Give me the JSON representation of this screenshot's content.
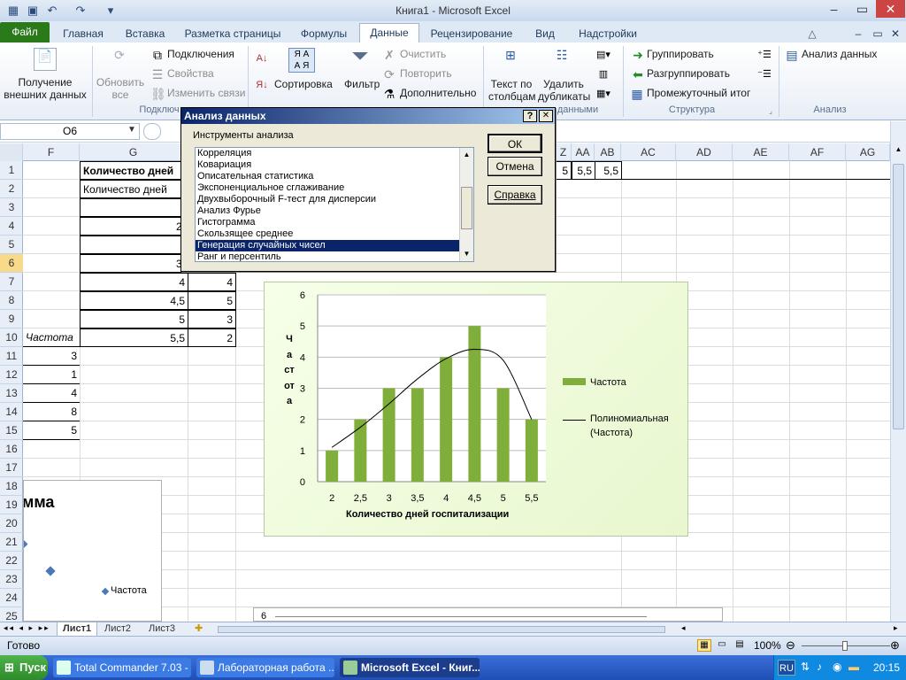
{
  "window": {
    "title": "Книга1  -  Microsoft Excel"
  },
  "tabs": [
    {
      "label": "Файл"
    },
    {
      "label": "Главная"
    },
    {
      "label": "Вставка"
    },
    {
      "label": "Разметка страницы"
    },
    {
      "label": "Формулы"
    },
    {
      "label": "Данные"
    },
    {
      "label": "Рецензирование"
    },
    {
      "label": "Вид"
    },
    {
      "label": "Надстройки"
    }
  ],
  "ribbon": {
    "get_data": "Получение внешних данных",
    "refresh": "Обновить все",
    "connections": "Подключения",
    "properties": "Свойства",
    "edit_links": "Изменить связи",
    "group_connections": "Подключ",
    "sort": "Сортировка",
    "filter": "Фильтр",
    "clear": "Очистить",
    "reapply": "Повторить",
    "advanced": "Дополнительно",
    "text_to_cols": "Текст по столбцам",
    "remove_dup": "Удалить дубликаты",
    "group_data": "данными",
    "group_btn": "Группировать",
    "ungroup_btn": "Разгруппировать",
    "subtotal": "Промежуточный итог",
    "group_structure": "Структура",
    "analysis_btn": "Анализ данных",
    "group_analysis": "Анализ"
  },
  "namebox": "O6",
  "columns": [
    "F",
    "G",
    "",
    "",
    "Z",
    "AA",
    "AB",
    "AC",
    "AD",
    "AE",
    "AF",
    "AG"
  ],
  "rows": [
    "1",
    "2",
    "3",
    "4",
    "5",
    "6",
    "7",
    "8",
    "9",
    "10",
    "11",
    "12",
    "13",
    "14",
    "15",
    "16",
    "17",
    "18",
    "19",
    "20",
    "21",
    "22",
    "23",
    "24",
    "25"
  ],
  "cells": {
    "g1": "Количество дней",
    "g2": "Количество дней",
    "g4": "2,",
    "g6": "3,",
    "g7": "4",
    "h7": "4",
    "g8": "4,5",
    "h8": "5",
    "g9": "5",
    "h9": "3",
    "g10": "5,5",
    "h10": "2",
    "f10": "Частота",
    "f11": "3",
    "f12": "1",
    "f13": "4",
    "f14": "8",
    "f15": "5",
    "z1": "5",
    "aa1": "5,5",
    "ab1": "5,5"
  },
  "dialog": {
    "title": "Анализ данных",
    "label": "Инструменты анализа",
    "items": [
      "Корреляция",
      "Ковариация",
      "Описательная статистика",
      "Экспоненциальное сглаживание",
      "Двухвыборочный F-тест для дисперсии",
      "Анализ Фурье",
      "Гистограмма",
      "Скользящее среднее",
      "Генерация случайных чисел",
      "Ранг и персентиль"
    ],
    "selected_index": 8,
    "ok": "ОК",
    "cancel": "Отмена",
    "help": "Справка",
    "help_btn": "?",
    "close_btn": "✕"
  },
  "chart_data": {
    "type": "bar",
    "categories": [
      "2",
      "2,5",
      "3",
      "3,5",
      "4",
      "4,5",
      "5",
      "5,5"
    ],
    "series": [
      {
        "name": "Частота",
        "values": [
          1,
          2,
          3,
          3,
          4,
          5,
          3,
          2
        ]
      }
    ],
    "trendline": {
      "name": "Полиномиальная (Частота)",
      "values": [
        1.1,
        1.75,
        2.5,
        3.3,
        3.95,
        4.25,
        3.9,
        2.0
      ]
    },
    "xlabel": "Количество  дней госпитализации",
    "ylabel": "Частота",
    "ylim": [
      0,
      6
    ],
    "yticks": [
      0,
      1,
      2,
      3,
      4,
      5,
      6
    ],
    "legend": [
      "Частота",
      "Полиномиальная",
      "(Частота)"
    ],
    "legend_position": "right",
    "bar_color": "#7fae3a"
  },
  "chart2": {
    "title_fragment": "мма",
    "legend": "Частота"
  },
  "chart3": {
    "tick": "6"
  },
  "sheets": [
    "Лист1",
    "Лист2",
    "Лист3"
  ],
  "status": {
    "ready": "Готово",
    "zoom": "100%"
  },
  "taskbar": {
    "start": "Пуск",
    "items": [
      "Total Commander 7.03 - ...",
      "Лабораторная работа ...",
      "Microsoft Excel - Книг..."
    ],
    "lang": "RU",
    "clock": "20:15"
  }
}
